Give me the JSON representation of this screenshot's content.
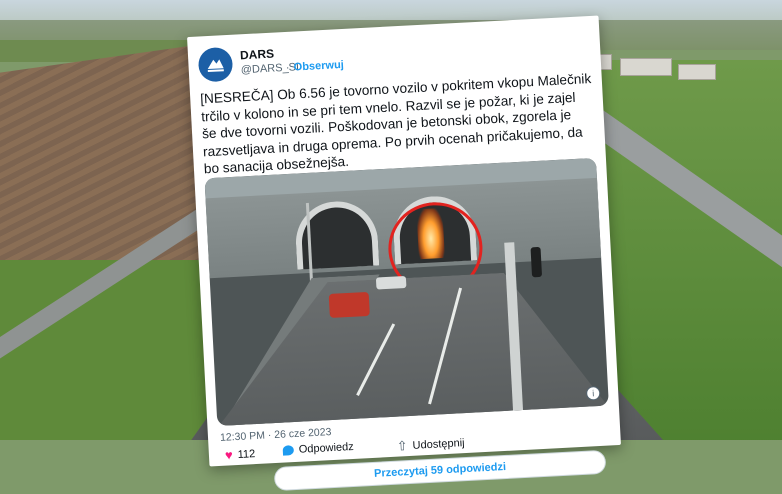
{
  "tweet": {
    "account_name": "DARS",
    "handle": "@DARS_SI",
    "separator": "·",
    "follow_label": "Obserwuj",
    "text": "[NESREČA] Ob 6.56 je tovorno vozilo v pokritem vkopu Malečnik trčilo v kolono in se pri tem vnelo. Razvil se je požar, ki je zajel še dve tovorni vozili. Poškodovan je betonski obok, zgorela je razsvetljava in druga oprema. Po prvih ocenah pričakujemo, da bo sanacija obsežnejša.",
    "timestamp": "12:30 PM · 26 cze 2023",
    "likes": "112",
    "reply_label": "Odpowiedz",
    "share_label": "Udostępnij",
    "read_replies_label": "Przeczytaj 59 odpowiedzi",
    "info_label": "i"
  },
  "colors": {
    "accent": "#1d9bf0",
    "like": "#f91880",
    "highlight_circle": "#e2231f",
    "avatar": "#1c5fa6"
  },
  "icons": [
    "dars-logo-icon",
    "heart-icon",
    "reply-icon",
    "share-icon",
    "info-icon"
  ]
}
